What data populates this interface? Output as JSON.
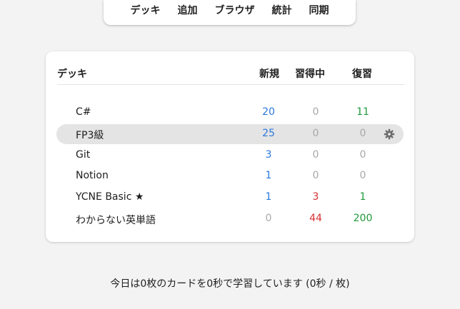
{
  "nav": {
    "items": [
      "デッキ",
      "追加",
      "ブラウザ",
      "統計",
      "同期"
    ]
  },
  "table": {
    "headers": {
      "deck": "デッキ",
      "new": "新規",
      "learning": "習得中",
      "review": "復習"
    },
    "rows": [
      {
        "name": "C#",
        "new": "20",
        "learning": "0",
        "review": "11",
        "selected": false
      },
      {
        "name": "FP3級",
        "new": "25",
        "learning": "0",
        "review": "0",
        "selected": true
      },
      {
        "name": "Git",
        "new": "3",
        "learning": "0",
        "review": "0",
        "selected": false
      },
      {
        "name": "Notion",
        "new": "1",
        "learning": "0",
        "review": "0",
        "selected": false
      },
      {
        "name": "YCNE Basic ★",
        "new": "1",
        "learning": "3",
        "review": "1",
        "selected": false
      },
      {
        "name": "わからない英単語",
        "new": "0",
        "learning": "44",
        "review": "200",
        "selected": false
      }
    ]
  },
  "summary": {
    "text": "今日は0枚のカードを0秒で学習しています (0秒 / 枚)"
  },
  "icons": {
    "options": "gear-icon"
  },
  "colors": {
    "new": "#2a78e0",
    "learning": "#d93030",
    "review": "#1e9a3a",
    "zero": "#a8a8a8",
    "selected_row": "#e4e4e4"
  }
}
